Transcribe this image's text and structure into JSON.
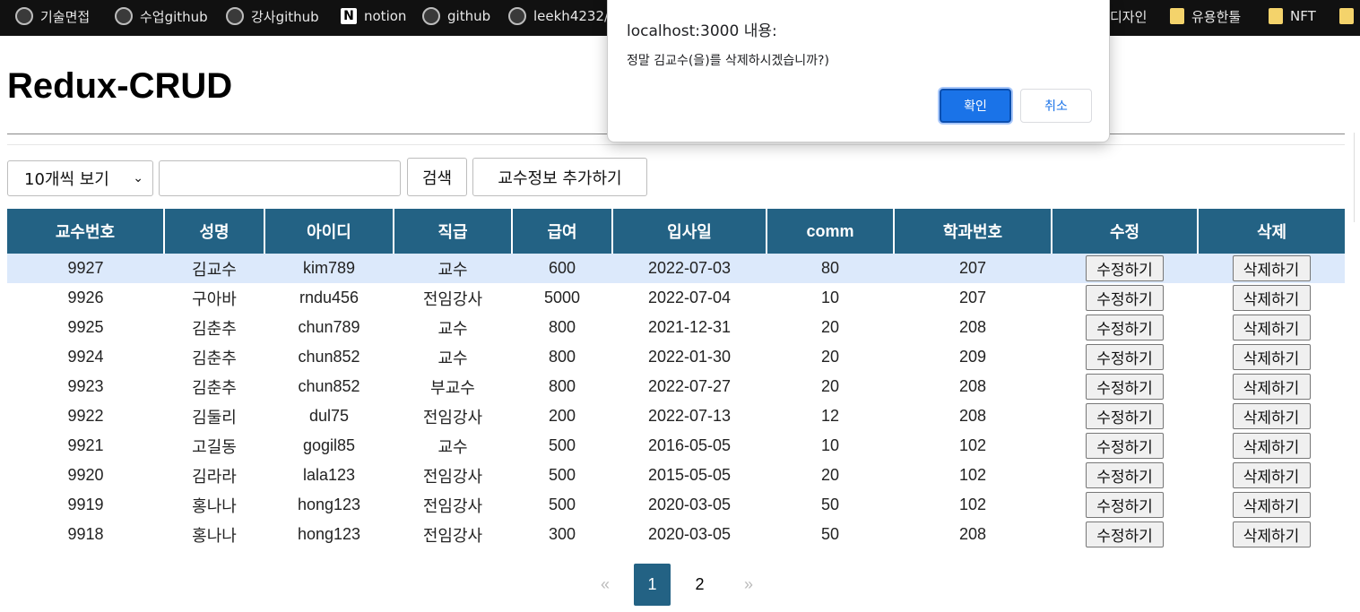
{
  "bookmarks": [
    {
      "label": "기술면접",
      "icon": "github-icon"
    },
    {
      "label": "수업github",
      "icon": "github-icon"
    },
    {
      "label": "강사github",
      "icon": "github-icon"
    },
    {
      "label": "notion",
      "icon": "notion-icon"
    },
    {
      "label": "github",
      "icon": "github-icon"
    },
    {
      "label": "leekh4232/m",
      "icon": "github-icon"
    },
    {
      "label": "디자인",
      "icon": "folder-icon"
    },
    {
      "label": "유용한툴",
      "icon": "folder-icon"
    },
    {
      "label": "NFT",
      "icon": "folder-icon"
    }
  ],
  "page": {
    "title": "Redux-CRUD"
  },
  "controls": {
    "page_size_selected": "10개씩 보기",
    "search_value": "",
    "search_label": "검색",
    "add_label": "교수정보 추가하기"
  },
  "table": {
    "headers": [
      "교수번호",
      "성명",
      "아이디",
      "직급",
      "급여",
      "입사일",
      "comm",
      "학과번호",
      "수정",
      "삭제"
    ],
    "rows": [
      [
        "9927",
        "김교수",
        "kim789",
        "교수",
        "600",
        "2022-07-03",
        "80",
        "207"
      ],
      [
        "9926",
        "구아바",
        "rndu456",
        "전임강사",
        "5000",
        "2022-07-04",
        "10",
        "207"
      ],
      [
        "9925",
        "김춘추",
        "chun789",
        "교수",
        "800",
        "2021-12-31",
        "20",
        "208"
      ],
      [
        "9924",
        "김춘추",
        "chun852",
        "교수",
        "800",
        "2022-01-30",
        "20",
        "209"
      ],
      [
        "9923",
        "김춘추",
        "chun852",
        "부교수",
        "800",
        "2022-07-27",
        "20",
        "208"
      ],
      [
        "9922",
        "김둘리",
        "dul75",
        "전임강사",
        "200",
        "2022-07-13",
        "12",
        "208"
      ],
      [
        "9921",
        "고길동",
        "gogil85",
        "교수",
        "500",
        "2016-05-05",
        "10",
        "102"
      ],
      [
        "9920",
        "김라라",
        "lala123",
        "전임강사",
        "500",
        "2015-05-05",
        "20",
        "102"
      ],
      [
        "9919",
        "홍나나",
        "hong123",
        "전임강사",
        "500",
        "2020-03-05",
        "50",
        "102"
      ],
      [
        "9918",
        "홍나나",
        "hong123",
        "전임강사",
        "300",
        "2020-03-05",
        "50",
        "208"
      ]
    ],
    "edit_label": "수정하기",
    "delete_label": "삭제하기",
    "highlighted_row": 0
  },
  "pagination": {
    "prev": "«",
    "pages": [
      "1",
      "2"
    ],
    "current": "1",
    "next": "»"
  },
  "dialog": {
    "title": "localhost:3000 내용:",
    "message": "정말 김교수(을)를 삭제하시겠습니까?)",
    "ok_label": "확인",
    "cancel_label": "취소"
  },
  "colors": {
    "header_bg": "#236284",
    "highlight_row": "#dce9fb",
    "dialog_ok": "#1a73e8"
  }
}
